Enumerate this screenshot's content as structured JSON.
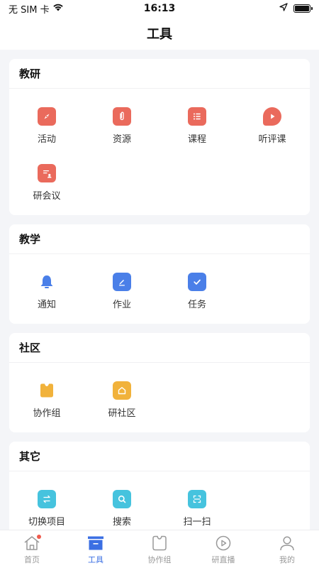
{
  "status": {
    "carrier": "无 SIM 卡",
    "time": "16:13"
  },
  "header": {
    "title": "工具"
  },
  "sections": [
    {
      "title": "教研",
      "items": [
        {
          "label": "活动",
          "icon": "compass-icon",
          "color": "#ea6a5c"
        },
        {
          "label": "资源",
          "icon": "paperclip-icon",
          "color": "#ea6a5c"
        },
        {
          "label": "课程",
          "icon": "list-icon",
          "color": "#ea6a5c"
        },
        {
          "label": "听评课",
          "icon": "play-icon",
          "color": "#ea6a5c"
        },
        {
          "label": "研会议",
          "icon": "meeting-icon",
          "color": "#ea6a5c"
        }
      ]
    },
    {
      "title": "教学",
      "items": [
        {
          "label": "通知",
          "icon": "bell-icon",
          "color": "#4a7fe8"
        },
        {
          "label": "作业",
          "icon": "pen-icon",
          "color": "#4a7fe8"
        },
        {
          "label": "任务",
          "icon": "check-icon",
          "color": "#4a7fe8"
        }
      ]
    },
    {
      "title": "社区",
      "items": [
        {
          "label": "协作组",
          "icon": "group-icon",
          "color": "#f1b23b"
        },
        {
          "label": "研社区",
          "icon": "home-icon",
          "color": "#f1b23b"
        }
      ]
    },
    {
      "title": "其它",
      "items": [
        {
          "label": "切换项目",
          "icon": "switch-icon",
          "color": "#46c3de"
        },
        {
          "label": "搜索",
          "icon": "search-icon",
          "color": "#46c3de"
        },
        {
          "label": "扫一扫",
          "icon": "scan-icon",
          "color": "#46c3de"
        }
      ]
    }
  ],
  "tabbar": {
    "tabs": [
      {
        "label": "首页",
        "icon": "home-tab-icon"
      },
      {
        "label": "工具",
        "icon": "toolbox-tab-icon"
      },
      {
        "label": "协作组",
        "icon": "group-tab-icon"
      },
      {
        "label": "研直播",
        "icon": "live-tab-icon"
      },
      {
        "label": "我的",
        "icon": "profile-tab-icon"
      }
    ],
    "active_index": 1,
    "active_color": "#3b6fe3",
    "inactive_color": "#999999"
  }
}
